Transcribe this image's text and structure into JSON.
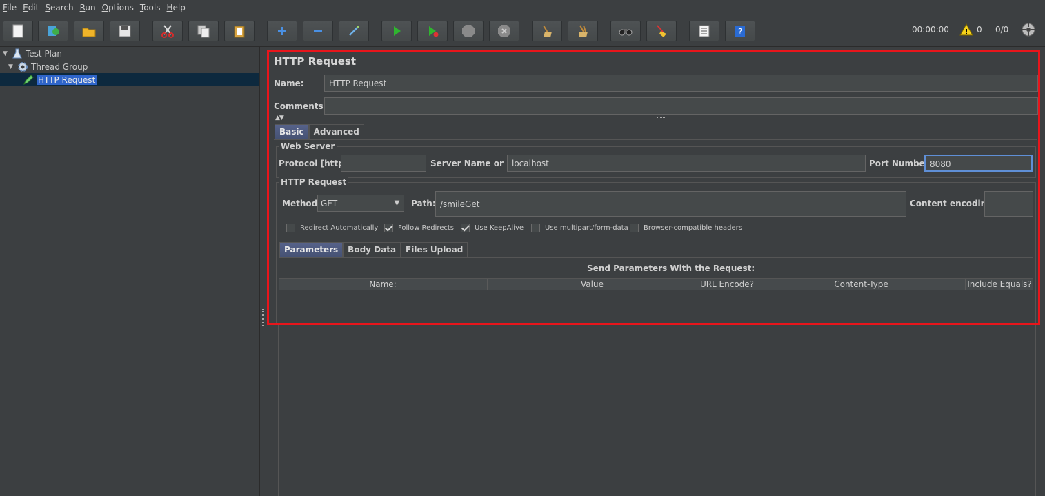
{
  "menu": [
    {
      "pre": "",
      "ul": "F",
      "post": "ile"
    },
    {
      "pre": "",
      "ul": "E",
      "post": "dit"
    },
    {
      "pre": "",
      "ul": "S",
      "post": "earch"
    },
    {
      "pre": "",
      "ul": "R",
      "post": "un"
    },
    {
      "pre": "",
      "ul": "O",
      "post": "ptions"
    },
    {
      "pre": "",
      "ul": "T",
      "post": "ools"
    },
    {
      "pre": "",
      "ul": "H",
      "post": "elp"
    }
  ],
  "toolbar": {
    "timer": "00:00:00",
    "warning_count": "0",
    "threads": "0/0"
  },
  "tree": {
    "test_plan": "Test Plan",
    "thread_group": "Thread Group",
    "http_request": "HTTP Request"
  },
  "panel": {
    "title": "HTTP Request",
    "name_label": "Name:",
    "name_value": "HTTP Request",
    "comments_label": "Comments:",
    "comments_value": "",
    "tabs": [
      "Basic",
      "Advanced"
    ],
    "web_server": {
      "title": "Web Server",
      "protocol_label": "Protocol [http]:",
      "protocol_value": "",
      "server_label": "Server Name or IP:",
      "server_value": "localhost",
      "port_label": "Port Number:",
      "port_value": "8080"
    },
    "http_request": {
      "title": "HTTP Request",
      "method_label": "Method:",
      "method_value": "GET",
      "path_label": "Path:",
      "path_value": "/smileGet",
      "encoding_label": "Content encoding:",
      "encoding_value": ""
    },
    "checkboxes": [
      {
        "label": "Redirect Automatically",
        "checked": false
      },
      {
        "label": "Follow Redirects",
        "checked": true
      },
      {
        "label": "Use KeepAlive",
        "checked": true
      },
      {
        "label": "Use multipart/form-data",
        "checked": false
      },
      {
        "label": "Browser-compatible headers",
        "checked": false
      }
    ],
    "param_tabs": [
      "Parameters",
      "Body Data",
      "Files Upload"
    ],
    "params_title": "Send Parameters With the Request:",
    "columns": [
      "Name:",
      "Value",
      "URL Encode?",
      "Content-Type",
      "Include Equals?"
    ]
  }
}
